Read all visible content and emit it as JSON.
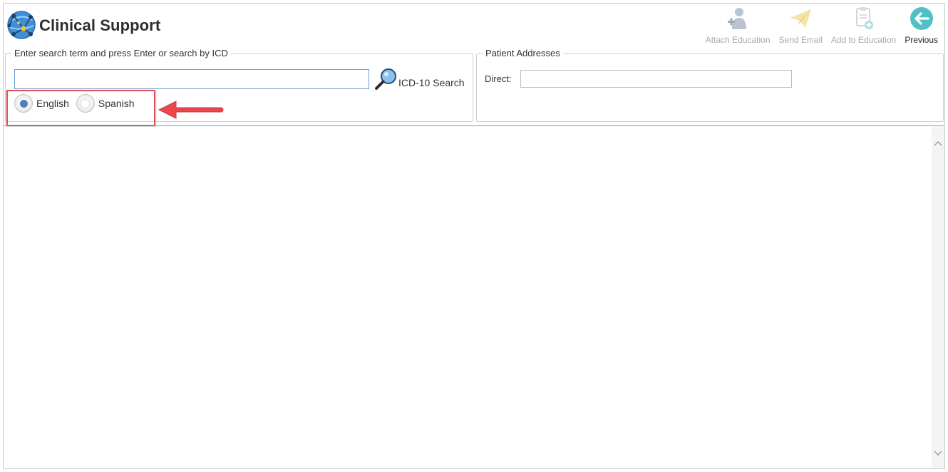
{
  "app": {
    "title": "Clinical Support",
    "logo_icon": "globe-network-icon"
  },
  "toolbar": {
    "buttons": [
      {
        "label": "Attach Education",
        "icon": "attach-education-icon",
        "enabled": false
      },
      {
        "label": "Send Email",
        "icon": "paper-plane-icon",
        "enabled": false
      },
      {
        "label": "Add to Education",
        "icon": "add-document-icon",
        "enabled": false
      },
      {
        "label": "Previous",
        "icon": "back-arrow-icon",
        "enabled": true
      }
    ]
  },
  "search": {
    "group_title": "Enter search term and press Enter or search by ICD",
    "input_value": "",
    "icd_button_label": "ICD-10 Search",
    "languages": [
      {
        "label": "English",
        "selected": true
      },
      {
        "label": "Spanish",
        "selected": false
      }
    ]
  },
  "patient": {
    "group_title": "Patient Addresses",
    "direct_label": "Direct:",
    "direct_value": ""
  },
  "colors": {
    "accent_teal": "#4fc1c6",
    "radio_selected": "#4f7fbf",
    "highlight_red": "#e0505a",
    "divider": "#6aa2a0"
  }
}
